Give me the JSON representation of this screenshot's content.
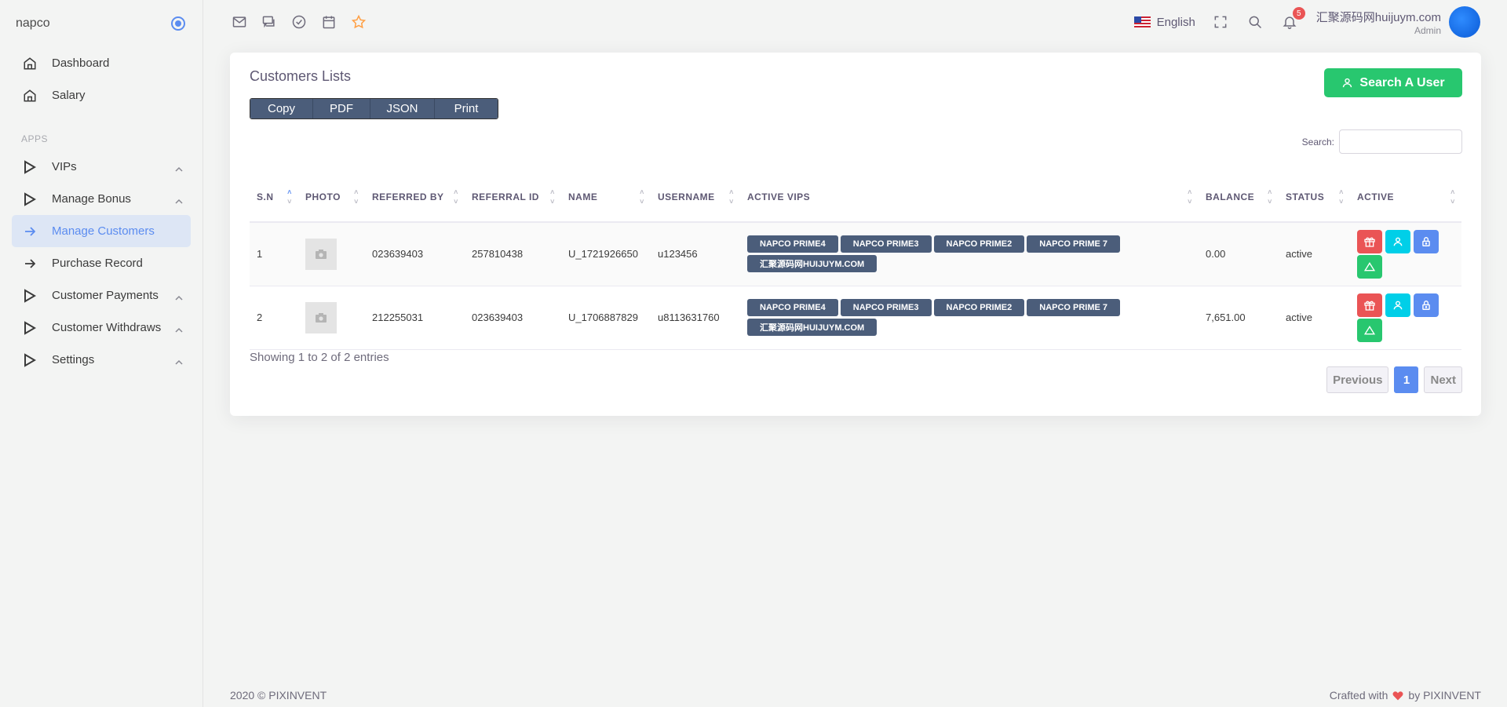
{
  "brand": {
    "name": "napco"
  },
  "sidebar": {
    "items": [
      {
        "label": "Dashboard",
        "icon": "home-icon"
      },
      {
        "label": "Salary",
        "icon": "home-icon"
      }
    ],
    "section_label": "APPS",
    "apps": [
      {
        "label": "VIPs",
        "icon": "play-icon",
        "expandable": true
      },
      {
        "label": "Manage Bonus",
        "icon": "play-icon",
        "expandable": true
      },
      {
        "label": "Manage Customers",
        "icon": "arrow-right-icon",
        "active": true
      },
      {
        "label": "Purchase Record",
        "icon": "arrow-right-icon"
      },
      {
        "label": "Customer Payments",
        "icon": "play-icon",
        "expandable": true
      },
      {
        "label": "Customer Withdraws",
        "icon": "play-icon",
        "expandable": true
      },
      {
        "label": "Settings",
        "icon": "play-icon",
        "expandable": true
      }
    ]
  },
  "topbar": {
    "icons": [
      "mail-icon",
      "chat-icon",
      "check-circle-icon",
      "calendar-icon",
      "star-icon"
    ],
    "language": "English",
    "notifications_count": "5",
    "user_name": "汇聚源码网huijuym.com",
    "user_role": "Admin"
  },
  "card": {
    "title": "Customers Lists",
    "export_buttons": [
      "Copy",
      "PDF",
      "JSON",
      "Print"
    ],
    "search_user_button": "Search A User",
    "search_label": "Search:",
    "columns": [
      "S.N",
      "PHOTO",
      "REFERRED BY",
      "REFERRAL ID",
      "NAME",
      "USERNAME",
      "ACTIVE VIPS",
      "BALANCE",
      "STATUS",
      "ACTIVE"
    ],
    "rows": [
      {
        "sn": "1",
        "referred_by": "023639403",
        "referral_id": "257810438",
        "name": "U_1721926650",
        "username": "u123456",
        "vips": [
          "NAPCO PRIME4",
          "NAPCO PRIME3",
          "NAPCO PRIME2",
          "NAPCO PRIME 7",
          "汇聚源码网HUIJUYM.COM"
        ],
        "balance": "0.00",
        "status": "active"
      },
      {
        "sn": "2",
        "referred_by": "212255031",
        "referral_id": "023639403",
        "name": "U_1706887829",
        "username": "u8113631760",
        "vips": [
          "NAPCO PRIME4",
          "NAPCO PRIME3",
          "NAPCO PRIME2",
          "NAPCO PRIME 7",
          "汇聚源码网HUIJUYM.COM"
        ],
        "balance": "7,651.00",
        "status": "active"
      }
    ],
    "info": "Showing 1 to 2 of 2 entries",
    "pager": {
      "previous": "Previous",
      "current": "1",
      "next": "Next"
    }
  },
  "footer": {
    "left": "2020 © PIXINVENT",
    "right_prefix": "Crafted with",
    "right_suffix": "by PIXINVENT"
  },
  "colors": {
    "accent": "#5b8cf0",
    "success": "#28c76f",
    "danger": "#ea5455",
    "info": "#00cfe8",
    "badge_bg": "#4b5d7a"
  }
}
